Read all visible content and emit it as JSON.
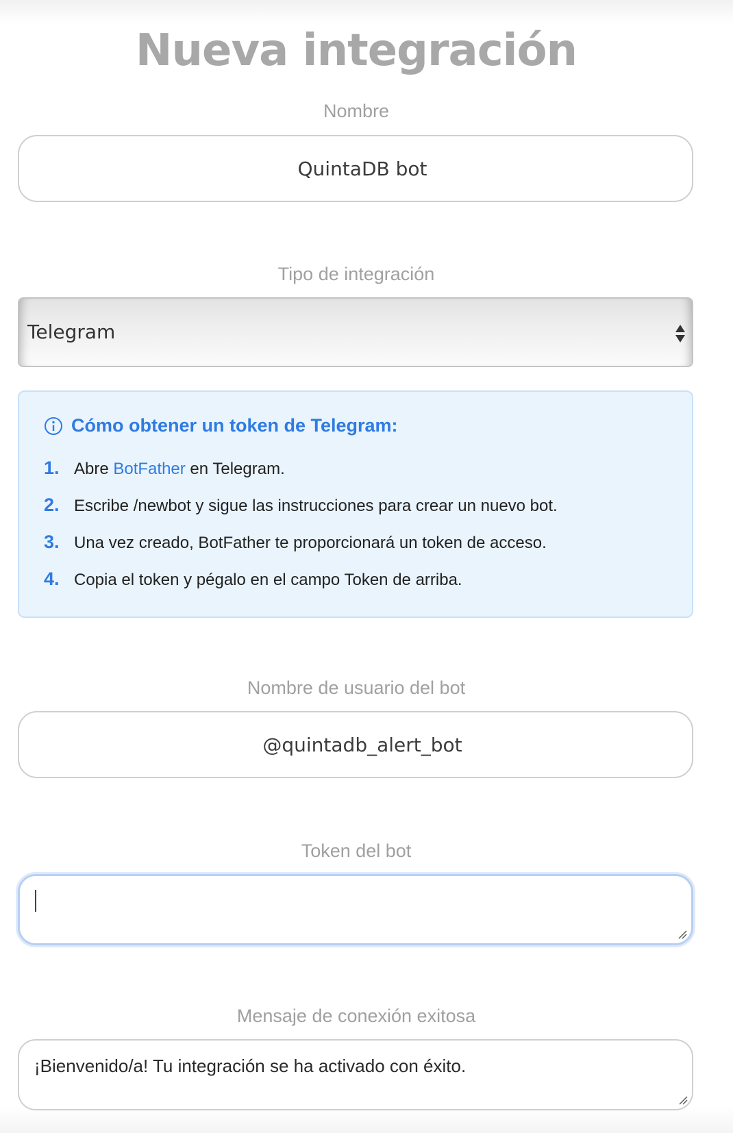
{
  "form": {
    "title": "Nueva integración",
    "name_label": "Nombre",
    "name_value": "QuintaDB bot",
    "type_label": "Tipo de integración",
    "type_value": "Telegram",
    "username_label": "Nombre de usuario del bot",
    "username_value": "@quintadb_alert_bot",
    "token_label": "Token del bot",
    "token_value": "",
    "message_label": "Mensaje de conexión exitosa",
    "message_value": "¡Bienvenido/a! Tu integración se ha activado con éxito."
  },
  "info": {
    "icon": "info-circle-icon",
    "heading": "Cómo obtener un token de Telegram:",
    "accent_color": "#2f7be2",
    "steps": [
      {
        "num": "1.",
        "pre": "Abre ",
        "link": "BotFather",
        "post": " en Telegram."
      },
      {
        "num": "2.",
        "text": "Escribe /newbot y sigue las instrucciones para crear un nuevo bot."
      },
      {
        "num": "3.",
        "text": "Una vez creado, BotFather te proporcionará un token de acceso."
      },
      {
        "num": "4.",
        "text": "Copia el token y pégalo en el campo Token de arriba."
      }
    ]
  }
}
